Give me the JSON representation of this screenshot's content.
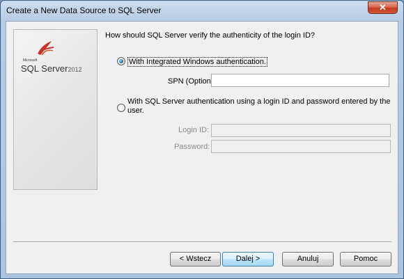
{
  "window": {
    "title": "Create a New Data Source to SQL Server",
    "close_label": "✕"
  },
  "logo": {
    "microsoft": "Microsoft",
    "product": "SQL Server",
    "version": "2012"
  },
  "question": "How should SQL Server verify the authenticity of the login ID?",
  "auth": {
    "integrated_label": "With Integrated Windows authentication.",
    "integrated_selected": true,
    "spn_label": "SPN (Optional):",
    "spn_value": "",
    "sql_label": "With SQL Server authentication using a login ID and password entered by the user.",
    "sql_selected": false,
    "login_label": "Login ID:",
    "login_value": "",
    "password_label": "Password:",
    "password_value": ""
  },
  "buttons": {
    "back": "< Wstecz",
    "next": "Dalej >",
    "cancel": "Anuluj",
    "help": "Pomoc"
  }
}
